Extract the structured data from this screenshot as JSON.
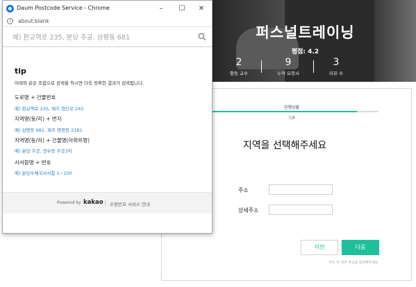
{
  "background_page": {
    "title": "퍼스널트레이닝",
    "rating": "평점: 4.2",
    "stats": [
      {
        "value": "2",
        "label": "활동 교수"
      },
      {
        "value": "9",
        "label": "누적 요청서"
      },
      {
        "value": "3",
        "label": "리뷰 수"
      }
    ],
    "progress": {
      "label": "진행상황",
      "count": "7/8",
      "fraction": 0.875,
      "color": "#1fbf9a"
    },
    "heading": "지역을 선택해주세요",
    "fields": {
      "address_label": "주소",
      "detail_label": "상세주소"
    },
    "buttons": {
      "prev": "이전",
      "next": "다음"
    },
    "hint": "주소 및 세부 주소를 입력해주세요."
  },
  "popup": {
    "window_title": "Daum Postcode Service - Chrome",
    "address_url": "about:blank",
    "search": {
      "placeholder": "예) 판교역로 235, 분당 주공, 삼평동 681",
      "icon": "search-icon"
    },
    "tip": {
      "title": "tip",
      "description": "아래와 같은 조합으로 검색을 하시면 더욱 정확한 결과가 검색됩니다.",
      "examples": [
        {
          "label": "도로명 + 건물번호",
          "example": "예) 판교역로 235, 제주 첨단로 242"
        },
        {
          "label": "지역명(동/리) + 번지",
          "example": "예) 삼평동 681, 제주 영평동 2181"
        },
        {
          "label": "지역명(동/리) + 건물명(아파트명)",
          "example": "예) 분당 주공, 연수동 주공3차"
        },
        {
          "label": "사서함명 + 번호",
          "example": "예) 분당우체국사서함 1~100"
        }
      ]
    },
    "footer": {
      "powered_by": "Powered by",
      "brand": "kakao",
      "service_link": "우편번호 서비스 안내"
    }
  }
}
